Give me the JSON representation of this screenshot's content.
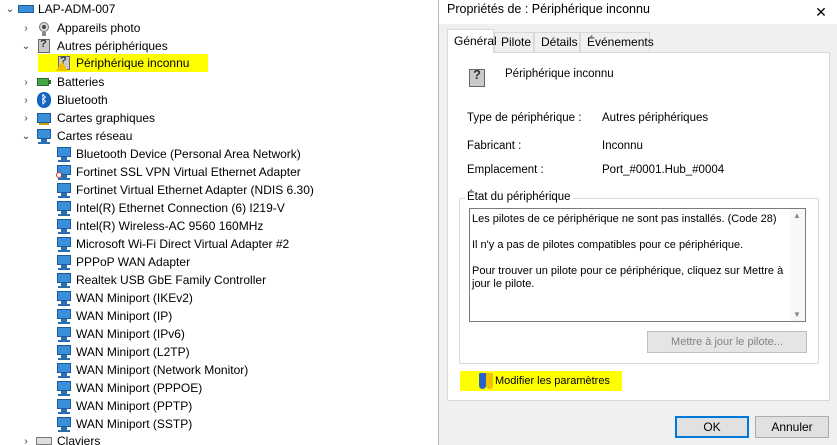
{
  "tree": {
    "root": "LAP-ADM-007",
    "categories": {
      "cameras": "Appareils photo",
      "other_devices": "Autres périphériques",
      "unknown_device": "Périphérique inconnu",
      "batteries": "Batteries",
      "bluetooth": "Bluetooth",
      "graphics": "Cartes graphiques",
      "network": "Cartes réseau",
      "keyboards": "Claviers"
    },
    "network_adapters": [
      "Bluetooth Device (Personal Area Network)",
      "Fortinet SSL VPN Virtual Ethernet Adapter",
      "Fortinet Virtual Ethernet Adapter (NDIS 6.30)",
      "Intel(R) Ethernet Connection (6) I219-V",
      "Intel(R) Wireless-AC 9560 160MHz",
      "Microsoft Wi-Fi Direct Virtual Adapter #2",
      "PPPoP WAN Adapter",
      "Realtek USB GbE Family Controller",
      "WAN Miniport (IKEv2)",
      "WAN Miniport (IP)",
      "WAN Miniport (IPv6)",
      "WAN Miniport (L2TP)",
      "WAN Miniport (Network Monitor)",
      "WAN Miniport (PPPOE)",
      "WAN Miniport (PPTP)",
      "WAN Miniport (SSTP)"
    ],
    "highlight_color": "#ffff00"
  },
  "dialog": {
    "title": "Propriétés de : Périphérique inconnu",
    "close_glyph": "✕",
    "tabs": [
      "Général",
      "Pilote",
      "Détails",
      "Événements"
    ],
    "active_tab": "Général",
    "device_name": "Périphérique inconnu",
    "properties": {
      "type_label": "Type de périphérique :",
      "type_value": "Autres périphériques",
      "manufacturer_label": "Fabricant :",
      "manufacturer_value": "Inconnu",
      "location_label": "Emplacement :",
      "location_value": "Port_#0001.Hub_#0004"
    },
    "status": {
      "group_title": "État du périphérique",
      "line1": "Les pilotes de ce périphérique ne sont pas installés. (Code 28)",
      "line2": "Il n'y a pas de pilotes compatibles pour ce périphérique.",
      "line3": "Pour trouver un pilote pour ce périphérique, cliquez sur Mettre à jour le pilote."
    },
    "update_driver_button": "Mettre à jour le pilote...",
    "change_settings_button": "Modifier les paramètres",
    "ok_button": "OK",
    "cancel_button": "Annuler",
    "accent_color": "#0078d7"
  }
}
